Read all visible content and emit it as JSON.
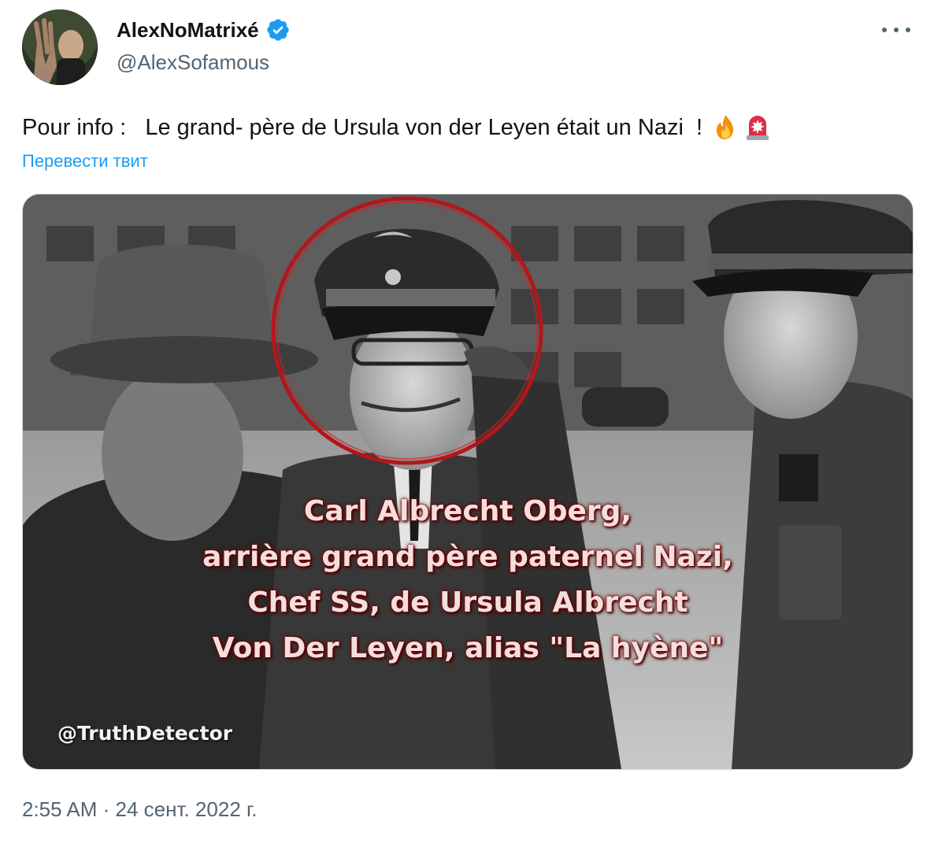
{
  "author": {
    "display_name": "AlexNoMatrixé",
    "handle": "@AlexSofamous",
    "verified": true
  },
  "tweet": {
    "text": "Pour info :   Le grand- père de Ursula von der Leyen était un Nazi  ! ",
    "emojis": [
      "fire-emoji",
      "rotating-light-emoji"
    ],
    "translate_label": "Перевести твит",
    "timestamp": "2:55 AM · 24 сент. 2022 г."
  },
  "media": {
    "caption_lines": [
      "Carl Albrecht Oberg,",
      "arrière grand père paternel Nazi,",
      "Chef SS, de Ursula Albrecht",
      "Von Der Leyen, alias \"La hyène\""
    ],
    "watermark": "@TruthDetector"
  },
  "colors": {
    "accent": "#1d9bf0",
    "secondary_text": "#536471",
    "primary_text": "#0f1419",
    "highlight_circle": "#b3161b"
  }
}
